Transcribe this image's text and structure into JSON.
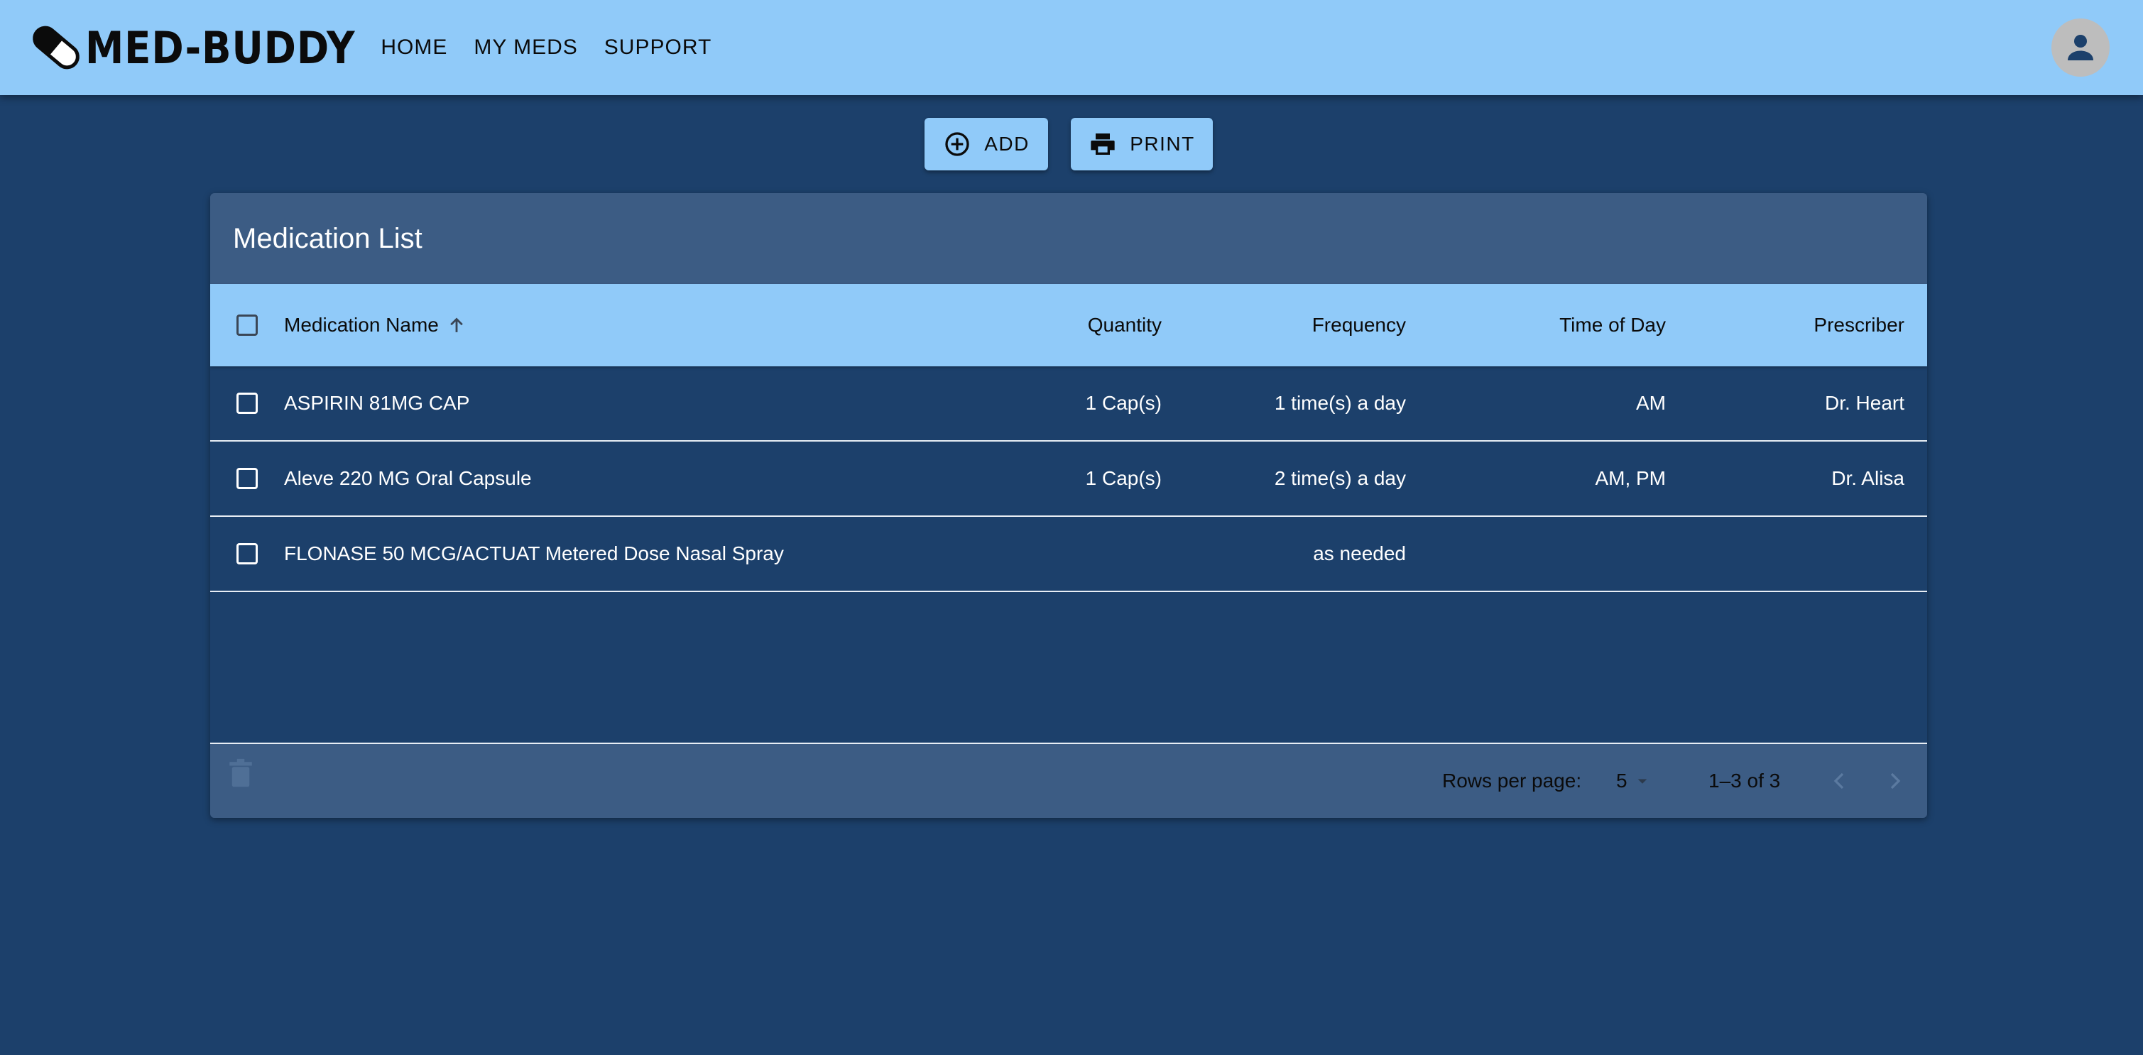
{
  "app": {
    "brand": "MED-BUDDY",
    "nav": [
      "HOME",
      "MY MEDS",
      "SUPPORT"
    ]
  },
  "actions": {
    "add_label": "ADD",
    "print_label": "PRINT"
  },
  "table": {
    "title": "Medication List",
    "columns": {
      "name": "Medication Name",
      "quantity": "Quantity",
      "frequency": "Frequency",
      "time": "Time of Day",
      "prescriber": "Prescriber"
    },
    "rows": [
      {
        "name": "ASPIRIN 81MG CAP",
        "quantity": "1 Cap(s)",
        "frequency": "1 time(s) a day",
        "time": "AM",
        "prescriber": "Dr. Heart"
      },
      {
        "name": "Aleve 220 MG Oral Capsule",
        "quantity": "1 Cap(s)",
        "frequency": "2 time(s) a day",
        "time": "AM, PM",
        "prescriber": "Dr. Alisa"
      },
      {
        "name": "FLONASE 50 MCG/ACTUAT Metered Dose Nasal Spray",
        "quantity": "",
        "frequency": "as needed",
        "time": "",
        "prescriber": ""
      }
    ],
    "sort": {
      "column": "name",
      "direction": "ascending"
    },
    "pagination": {
      "rows_per_page_label": "Rows per page:",
      "rows_per_page": "5",
      "range": "1–3 of 3"
    }
  },
  "icons": {
    "logo": "pill-icon",
    "account": "account-circle-icon",
    "add": "add-circle-outline-icon",
    "print": "printer-icon",
    "sort": "arrow-up-icon",
    "delete": "trash-icon",
    "prev": "chevron-left-icon",
    "next": "chevron-right-icon"
  },
  "colors": {
    "appbar": "#90caf9",
    "background": "#1c406b",
    "card_header": "#3c5c84"
  }
}
